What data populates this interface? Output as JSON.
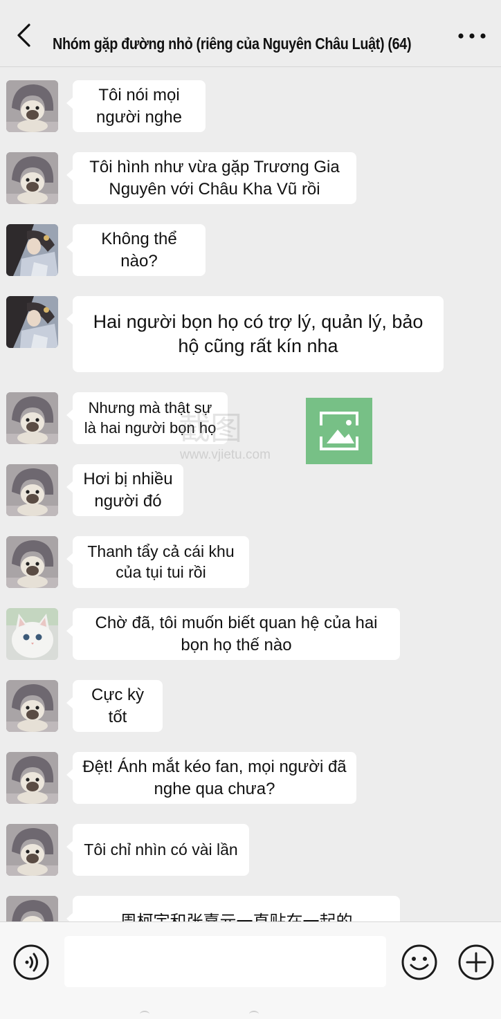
{
  "header": {
    "title": "Nhóm gặp đường nhỏ (riêng của Nguyên Châu Luật) (64)",
    "back_icon": "chevron-left-icon",
    "more_icon": "more-dots-icon"
  },
  "messages": [
    {
      "avatar": "pug-avatar",
      "text": "Tôi nói mọi người nghe"
    },
    {
      "avatar": "pug-avatar",
      "text": "Tôi hình như vừa gặp Trương Gia Nguyên với Châu Kha Vũ rồi"
    },
    {
      "avatar": "girl-avatar",
      "text": "Không thể nào?"
    },
    {
      "avatar": "girl-avatar",
      "text": "Hai người bọn họ có trợ lý, quản lý, bảo hộ cũng rất kín nha"
    },
    {
      "avatar": "pug-avatar",
      "text": "Nhưng mà thật sự là hai người bọn họ"
    },
    {
      "avatar": "pug-avatar",
      "text": "Hơi bị nhiều người đó"
    },
    {
      "avatar": "pug-avatar",
      "text": "Thanh tẩy cả cái khu của tụi tui rồi"
    },
    {
      "avatar": "cat-avatar",
      "text": "Chờ đã, tôi muốn biết quan hệ của hai bọn họ thế nào"
    },
    {
      "avatar": "pug-avatar",
      "text": "Cực kỳ tốt"
    },
    {
      "avatar": "pug-avatar",
      "text": "Đệt! Ánh mắt kéo fan, mọi người đã nghe qua chưa?"
    },
    {
      "avatar": "pug-avatar",
      "text": "Tôi chỉ nhìn có vài lần"
    },
    {
      "avatar": "pug-avatar",
      "text": "周柯宇和张嘉元一直贴在一起的"
    }
  ],
  "watermark": {
    "text": "截图",
    "url": "www.vjietu.com"
  },
  "input_bar": {
    "value": "",
    "voice_icon": "voice-icon",
    "emoji_icon": "emoji-icon",
    "plus_icon": "plus-icon"
  },
  "colors": {
    "background": "#ededed",
    "bubble": "#ffffff",
    "watermark_green": "#4fb063"
  }
}
